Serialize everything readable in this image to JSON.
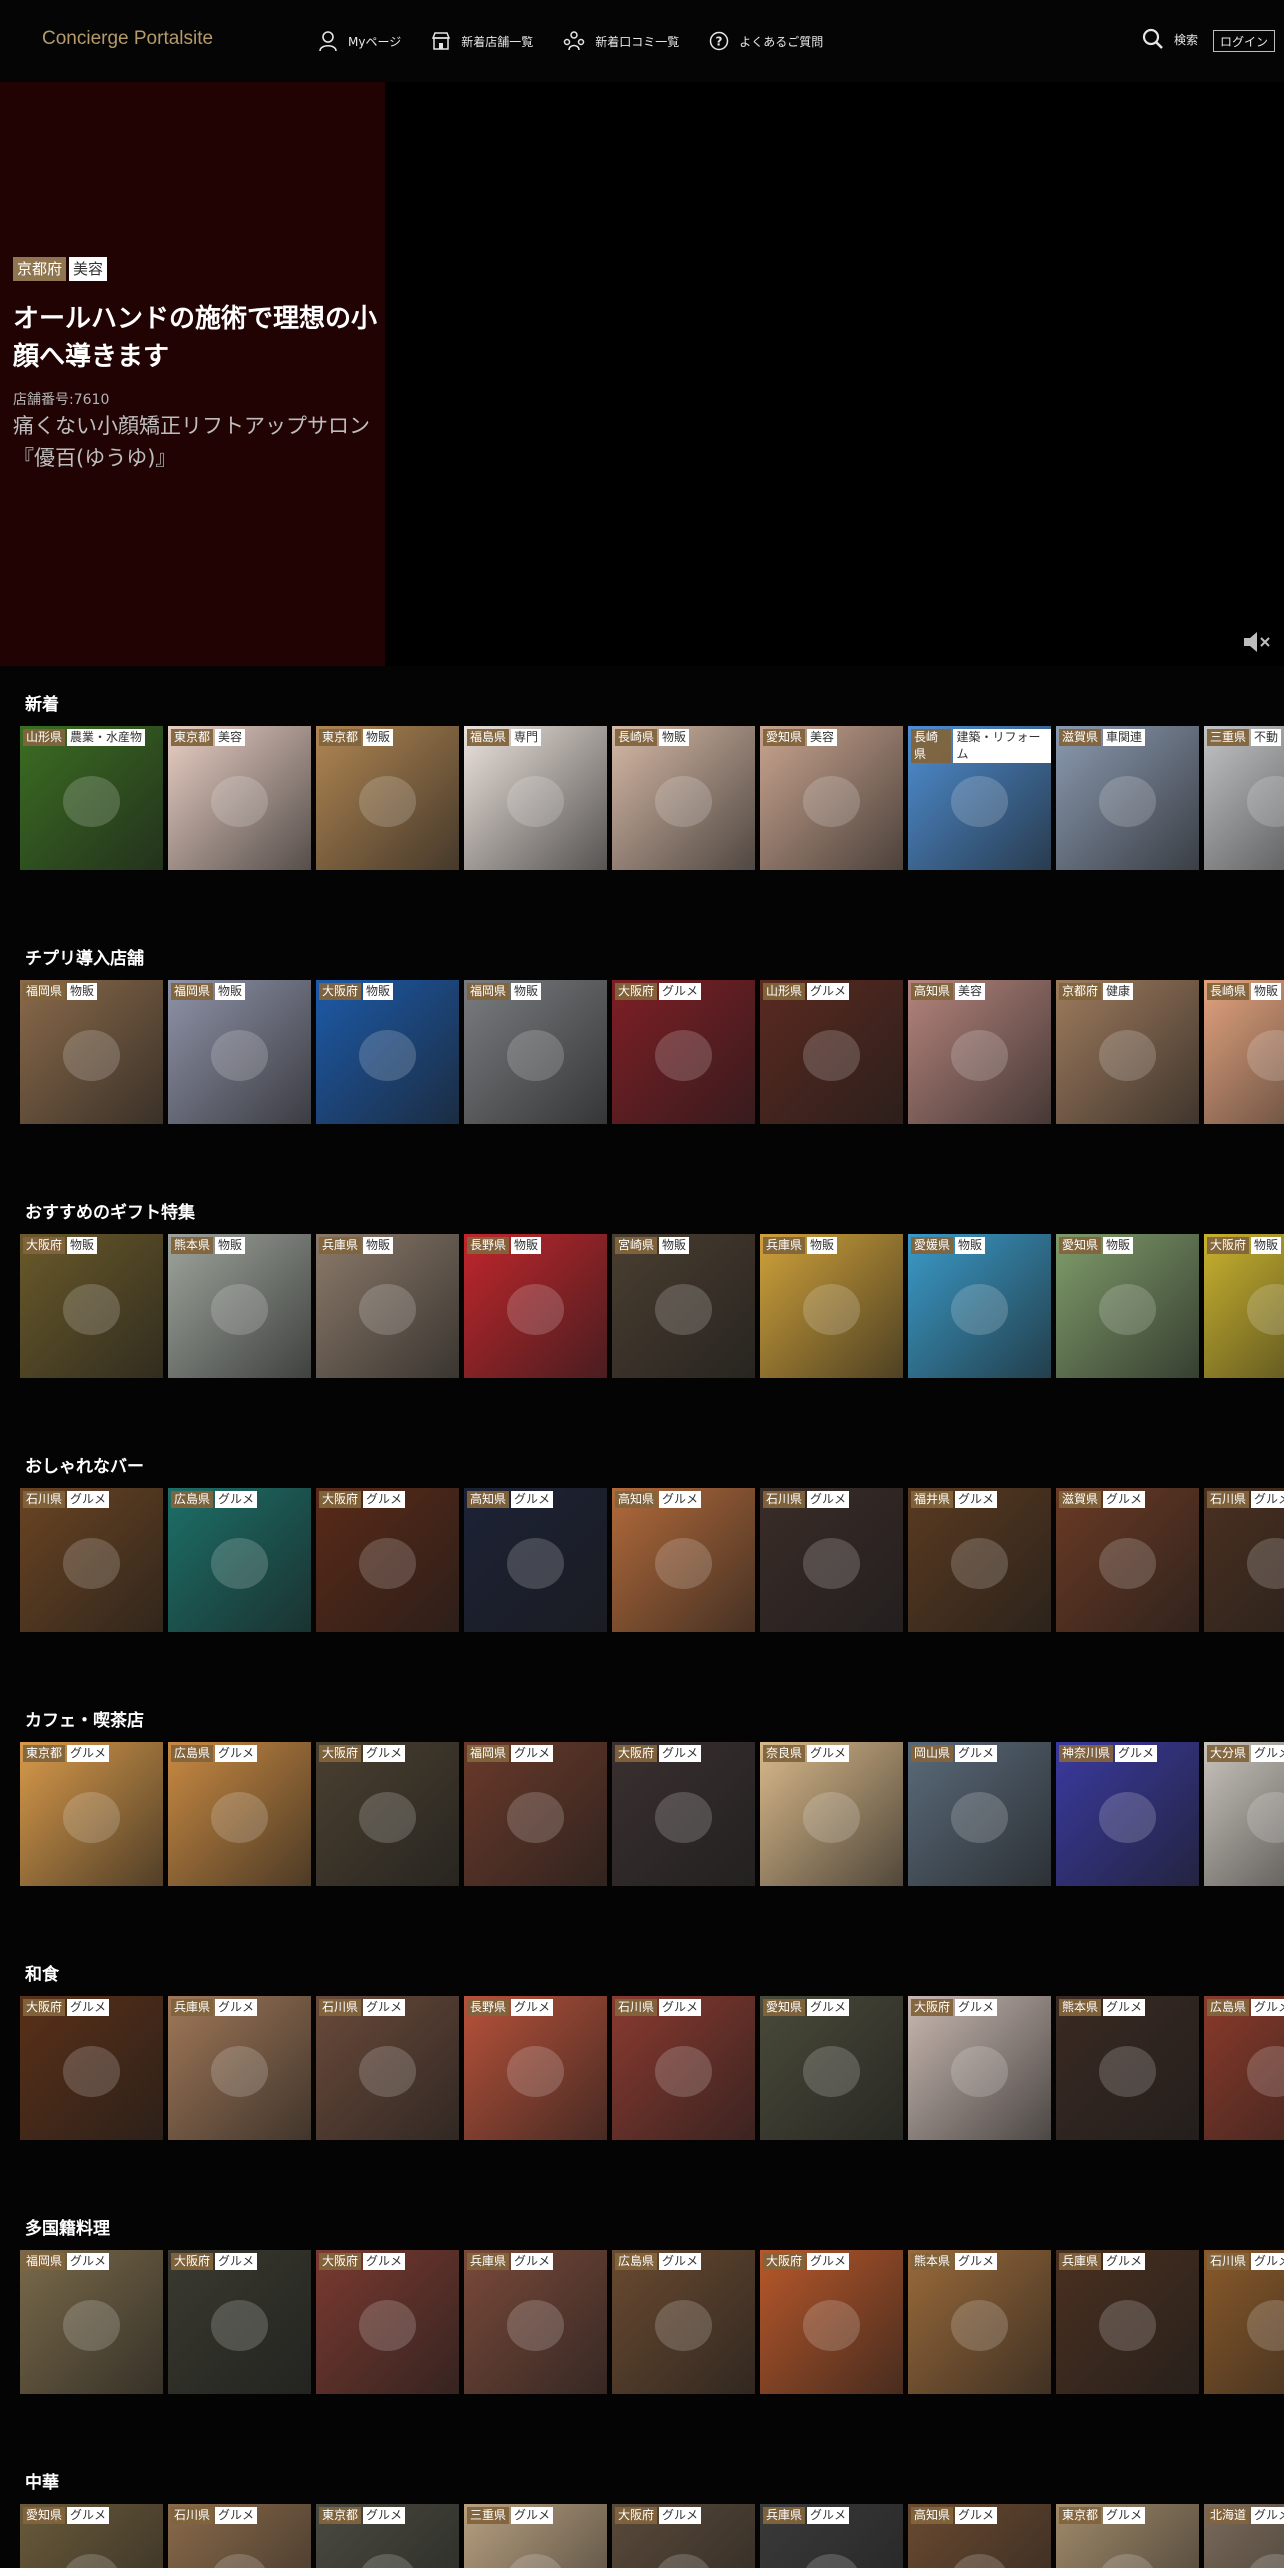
{
  "header": {
    "logo": "Concierge Portalsite",
    "nav": [
      {
        "label": "Myページ",
        "icon": "user-icon"
      },
      {
        "label": "新着店舗一覧",
        "icon": "store-icon"
      },
      {
        "label": "新着口コミ一覧",
        "icon": "reviews-icon"
      },
      {
        "label": "よくあるご質問",
        "icon": "question-icon"
      }
    ],
    "search_label": "検索",
    "login_label": "ログイン"
  },
  "hero": {
    "prefecture": "京都府",
    "category": "美容",
    "title": "オールハンドの施術で理想の小顔へ導きます",
    "shop_number": "店舗番号:7610",
    "description": "痛くない小顔矯正リフトアップサロン『優百(ゆうゆ)』",
    "mute_icon": "mute-icon"
  },
  "sections": [
    {
      "title": "新着",
      "cards": [
        {
          "pref": "山形県",
          "cat": "農業・水産物",
          "color": "#3b6e22"
        },
        {
          "pref": "東京都",
          "cat": "美容",
          "color": "#e9cfc4"
        },
        {
          "pref": "東京都",
          "cat": "物販",
          "color": "#b08652"
        },
        {
          "pref": "福島県",
          "cat": "専門",
          "color": "#ece3dd"
        },
        {
          "pref": "長崎県",
          "cat": "物販",
          "color": "#d6b9a6"
        },
        {
          "pref": "愛知県",
          "cat": "美容",
          "color": "#c9a48f"
        },
        {
          "pref": "長崎県",
          "cat": "建築・リフォーム",
          "color": "#4f8fd4"
        },
        {
          "pref": "滋賀県",
          "cat": "車関連",
          "color": "#8b9ab0"
        },
        {
          "pref": "三重県",
          "cat": "不動",
          "color": "#c2c4c5"
        }
      ]
    },
    {
      "title": "チプリ導入店舗",
      "cards": [
        {
          "pref": "福岡県",
          "cat": "物販",
          "color": "#8a6a4a"
        },
        {
          "pref": "福岡県",
          "cat": "物販",
          "color": "#8f93a8"
        },
        {
          "pref": "大阪府",
          "cat": "物販",
          "color": "#1d5aa8"
        },
        {
          "pref": "福岡県",
          "cat": "物販",
          "color": "#7a7d80"
        },
        {
          "pref": "大阪府",
          "cat": "グルメ",
          "color": "#7e1f25"
        },
        {
          "pref": "山形県",
          "cat": "グルメ",
          "color": "#5a2a20"
        },
        {
          "pref": "高知県",
          "cat": "美容",
          "color": "#b4847c"
        },
        {
          "pref": "京都府",
          "cat": "健康",
          "color": "#9e7b5d"
        },
        {
          "pref": "長崎県",
          "cat": "物販",
          "color": "#e3a37e"
        }
      ]
    },
    {
      "title": "おすすめのギフト特集",
      "cards": [
        {
          "pref": "大阪府",
          "cat": "物販",
          "color": "#6a5a2a"
        },
        {
          "pref": "熊本県",
          "cat": "物販",
          "color": "#9ea59c"
        },
        {
          "pref": "兵庫県",
          "cat": "物販",
          "color": "#8b7a6a"
        },
        {
          "pref": "長野県",
          "cat": "物販",
          "color": "#c0262c"
        },
        {
          "pref": "宮崎県",
          "cat": "物販",
          "color": "#4a3e30"
        },
        {
          "pref": "兵庫県",
          "cat": "物販",
          "color": "#cfa13a"
        },
        {
          "pref": "愛媛県",
          "cat": "物販",
          "color": "#3a9ac8"
        },
        {
          "pref": "愛知県",
          "cat": "物販",
          "color": "#7f9c6a"
        },
        {
          "pref": "大阪府",
          "cat": "物販",
          "color": "#c9b22e"
        }
      ]
    },
    {
      "title": "おしゃれなバー",
      "cards": [
        {
          "pref": "石川県",
          "cat": "グルメ",
          "color": "#6a4422"
        },
        {
          "pref": "広島県",
          "cat": "グルメ",
          "color": "#1c6f68"
        },
        {
          "pref": "大阪府",
          "cat": "グルメ",
          "color": "#5a2a18"
        },
        {
          "pref": "高知県",
          "cat": "グルメ",
          "color": "#1c2236"
        },
        {
          "pref": "高知県",
          "cat": "グルメ",
          "color": "#b26a3a"
        },
        {
          "pref": "石川県",
          "cat": "グルメ",
          "color": "#3a2c28"
        },
        {
          "pref": "福井県",
          "cat": "グルメ",
          "color": "#5a3a20"
        },
        {
          "pref": "滋賀県",
          "cat": "グルメ",
          "color": "#6a3a24"
        },
        {
          "pref": "石川県",
          "cat": "グルメ",
          "color": "#4a3020"
        }
      ]
    },
    {
      "title": "カフェ・喫茶店",
      "cards": [
        {
          "pref": "東京都",
          "cat": "グルメ",
          "color": "#d89a4a"
        },
        {
          "pref": "広島県",
          "cat": "グルメ",
          "color": "#c98a42"
        },
        {
          "pref": "大阪府",
          "cat": "グルメ",
          "color": "#4a4030"
        },
        {
          "pref": "福岡県",
          "cat": "グルメ",
          "color": "#6a3a2a"
        },
        {
          "pref": "大阪府",
          "cat": "グルメ",
          "color": "#3a3030"
        },
        {
          "pref": "奈良県",
          "cat": "グルメ",
          "color": "#d9b98a"
        },
        {
          "pref": "岡山県",
          "cat": "グルメ",
          "color": "#5a6a7a"
        },
        {
          "pref": "神奈川県",
          "cat": "グルメ",
          "color": "#3a3aa0"
        },
        {
          "pref": "大分県",
          "cat": "グルメ",
          "color": "#c9c4bc"
        }
      ]
    },
    {
      "title": "和食",
      "cards": [
        {
          "pref": "大阪府",
          "cat": "グルメ",
          "color": "#5a3018"
        },
        {
          "pref": "兵庫県",
          "cat": "グルメ",
          "color": "#a07858"
        },
        {
          "pref": "石川県",
          "cat": "グルメ",
          "color": "#6a4a3a"
        },
        {
          "pref": "長野県",
          "cat": "グルメ",
          "color": "#b8523a"
        },
        {
          "pref": "石川県",
          "cat": "グルメ",
          "color": "#8a3a30"
        },
        {
          "pref": "愛知県",
          "cat": "グルメ",
          "color": "#4a4a3a"
        },
        {
          "pref": "大阪府",
          "cat": "グルメ",
          "color": "#c8b8b0"
        },
        {
          "pref": "熊本県",
          "cat": "グルメ",
          "color": "#3a2a22"
        },
        {
          "pref": "広島県",
          "cat": "グルメ",
          "color": "#8a3a2a"
        }
      ]
    },
    {
      "title": "多国籍料理",
      "cards": [
        {
          "pref": "福岡県",
          "cat": "グルメ",
          "color": "#7a6a4a"
        },
        {
          "pref": "大阪府",
          "cat": "グルメ",
          "color": "#3a3a30"
        },
        {
          "pref": "大阪府",
          "cat": "グルメ",
          "color": "#7a3a30"
        },
        {
          "pref": "兵庫県",
          "cat": "グルメ",
          "color": "#7a4a3a"
        },
        {
          "pref": "広島県",
          "cat": "グルメ",
          "color": "#6a4a30"
        },
        {
          "pref": "大阪府",
          "cat": "グルメ",
          "color": "#b8582a"
        },
        {
          "pref": "熊本県",
          "cat": "グルメ",
          "color": "#9a6a3a"
        },
        {
          "pref": "兵庫県",
          "cat": "グルメ",
          "color": "#4a3020"
        },
        {
          "pref": "石川県",
          "cat": "グルメ",
          "color": "#8a5a2a"
        }
      ]
    },
    {
      "title": "中華",
      "cards": [
        {
          "pref": "愛知県",
          "cat": "グルメ",
          "color": "#6a5a3a"
        },
        {
          "pref": "石川県",
          "cat": "グルメ",
          "color": "#8a6a4a"
        },
        {
          "pref": "東京都",
          "cat": "グルメ",
          "color": "#4a4a40"
        },
        {
          "pref": "三重県",
          "cat": "グルメ",
          "color": "#b8a080"
        },
        {
          "pref": "大阪府",
          "cat": "グルメ",
          "color": "#5a4a3a"
        },
        {
          "pref": "兵庫県",
          "cat": "グルメ",
          "color": "#3a3a3a"
        },
        {
          "pref": "高知県",
          "cat": "グルメ",
          "color": "#6a4a30"
        },
        {
          "pref": "東京都",
          "cat": "グルメ",
          "color": "#a08a6a"
        },
        {
          "pref": "北海道",
          "cat": "グルメ",
          "color": "#7a6a5a"
        }
      ]
    }
  ]
}
